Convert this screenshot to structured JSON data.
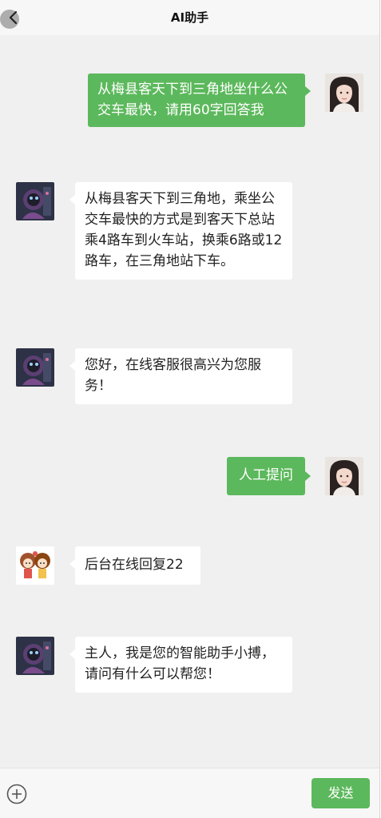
{
  "header": {
    "title": "AI助手",
    "back_icon": "chevron-left-icon"
  },
  "messages": [
    {
      "side": "right",
      "sender": "user",
      "text": "从梅县客天下到三角地坐什么公交车最快，请用60字回答我"
    },
    {
      "side": "left",
      "sender": "assistant",
      "text": "从梅县客天下到三角地，乘坐公交车最快的方式是到客天下总站乘4路车到火车站，换乘6路或12路车，在三角地站下车。"
    },
    {
      "side": "left",
      "sender": "assistant",
      "text": "您好，在线客服很高兴为您服务！"
    },
    {
      "side": "right",
      "sender": "user",
      "text": "人工提问"
    },
    {
      "side": "left",
      "sender": "agent",
      "text": "后台在线回复22"
    },
    {
      "side": "left",
      "sender": "assistant",
      "text": "主人，我是您的智能助手小搏，请问有什么可以帮您！"
    }
  ],
  "footer": {
    "plus_icon": "plus-circle-icon",
    "input_value": "",
    "send_label": "发送"
  },
  "colors": {
    "accent_green": "#5cb85c",
    "chat_background": "#f0f0f0",
    "bubble_left": "#ffffff"
  }
}
